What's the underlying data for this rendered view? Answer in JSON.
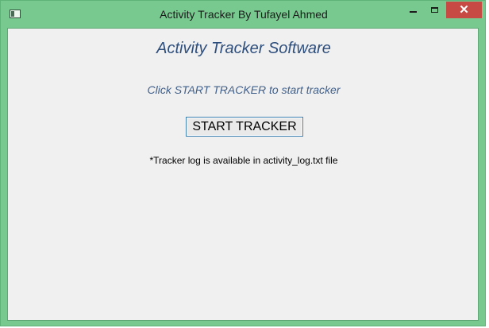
{
  "window": {
    "title": "Activity Tracker By Tufayel Ahmed",
    "icons": {
      "app": "app-window-icon",
      "minimize": "minimize-icon",
      "maximize": "maximize-icon",
      "close": "close-icon"
    },
    "colors": {
      "frame": "#78c98f",
      "close_button": "#c74a45",
      "client_background": "#f0f0f0"
    }
  },
  "main": {
    "heading": "Activity Tracker Software",
    "hint": "Click START TRACKER to start tracker",
    "start_button_label": "START TRACKER",
    "log_note": "*Tracker log is available in activity_log.txt file",
    "colors": {
      "heading": "#2e4f7d",
      "hint": "#3f5f8a",
      "button_border": "#3c7fb1"
    }
  }
}
